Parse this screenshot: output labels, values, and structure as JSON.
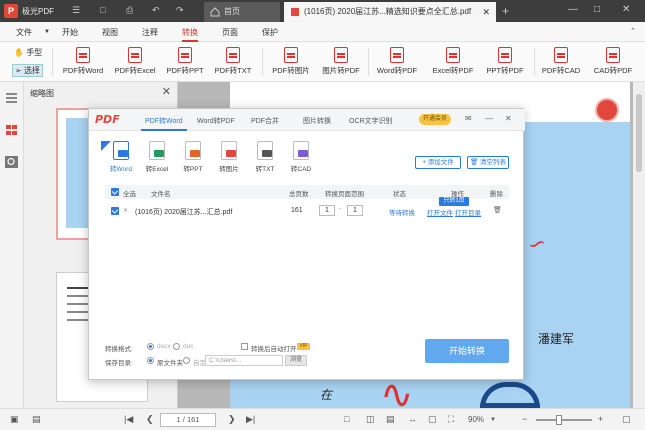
{
  "app": {
    "name": "极光PDF"
  },
  "tabs": [
    {
      "label": "首页"
    },
    {
      "label": "(1016页) 2020届江苏...精选知识要点全汇总.pdf"
    }
  ],
  "menu": [
    "文件",
    "开始",
    "视图",
    "注释",
    "转换",
    "页面",
    "保护"
  ],
  "menu_active": "转换",
  "toolbar": {
    "hand": "手型",
    "select": "选择",
    "buttons": [
      "PDF转Word",
      "PDF转Excel",
      "PDF转PPT",
      "PDF转TXT",
      "PDF转图片",
      "图片转PDF",
      "Word转PDF",
      "Excel转PDF",
      "PPT转PDF",
      "PDF转CAD",
      "CAD转PDF"
    ]
  },
  "thumbnail_panel": {
    "title": "缩略图"
  },
  "document": {
    "text_name": "潘建军",
    "text_zai": "在"
  },
  "statusbar": {
    "page": "1 / 161",
    "zoom": "90%"
  },
  "dialog": {
    "logo": "PDF",
    "tabs": [
      "PDF转Word",
      "Word转PDF",
      "PDF合并",
      "图片转换",
      "OCR文字识别"
    ],
    "active_tab": "PDF转Word",
    "vip": "开通会员",
    "formats": [
      {
        "label": "转Word",
        "color": "#2a7ae2"
      },
      {
        "label": "转Excel",
        "color": "#1e9e5a"
      },
      {
        "label": "转PPT",
        "color": "#e2632a"
      },
      {
        "label": "转图片",
        "color": "#e2473c"
      },
      {
        "label": "转TXT",
        "color": "#555555"
      },
      {
        "label": "转CAD",
        "color": "#7a5ad8"
      }
    ],
    "add_file": "添加文件",
    "clear_list": "清空列表",
    "columns": [
      "全选",
      "文件名",
      "总页数",
      "转换页面范围",
      "状态",
      "操作",
      "删除"
    ],
    "row": {
      "filename": "(1016页) 2020届江苏...汇总.pdf",
      "pages": "161",
      "range_from": "1",
      "range_to": "1",
      "status": "等待转换",
      "op_open": "打开文件",
      "op_folder": "打开目录"
    },
    "tooltip": "只转1页",
    "output_format_label": "转换格式:",
    "output_formats": [
      "docx",
      "doc"
    ],
    "output_dir_label": "保存目录:",
    "output_dirs": [
      "原文件夹",
      "自定义"
    ],
    "path_placeholder": "C:\\Users\\...",
    "browse": "浏览",
    "option": "转换后自动打开",
    "convert_button": "开始转换"
  }
}
